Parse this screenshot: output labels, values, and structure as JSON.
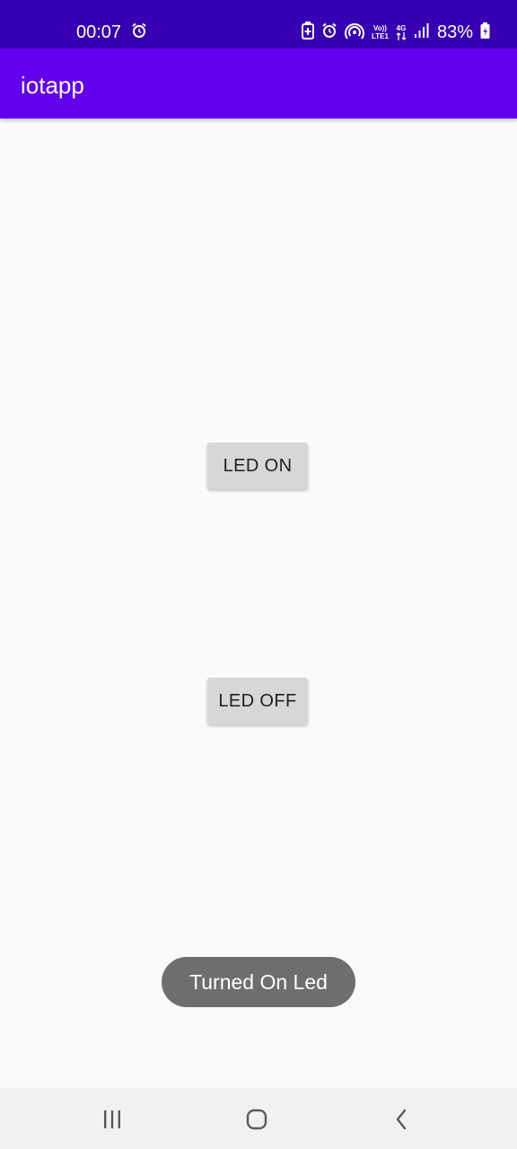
{
  "status_bar": {
    "time": "00:07",
    "battery_percent": "83%",
    "volte_label_top": "Vo))",
    "volte_label_bottom": "LTE1",
    "network_label": "4G",
    "icons": [
      "alarm-icon",
      "battery-saver-icon",
      "alarm-icon",
      "hotspot-icon",
      "volte-icon",
      "data-arrows-icon",
      "signal-icon",
      "battery-charging-icon"
    ]
  },
  "app_bar": {
    "title": "iotapp"
  },
  "main": {
    "led_on_label": "LED ON",
    "led_off_label": "LED OFF"
  },
  "toast": {
    "message": "Turned On Led"
  },
  "nav_bar": {
    "icons": [
      "recents-icon",
      "home-icon",
      "back-icon"
    ]
  },
  "colors": {
    "status_bar": "#3700b3",
    "app_bar": "#6200ee",
    "background": "#fafafa",
    "button": "#d6d7d7",
    "toast": "#6e6e6e",
    "nav_bar": "#f1f1f1"
  }
}
